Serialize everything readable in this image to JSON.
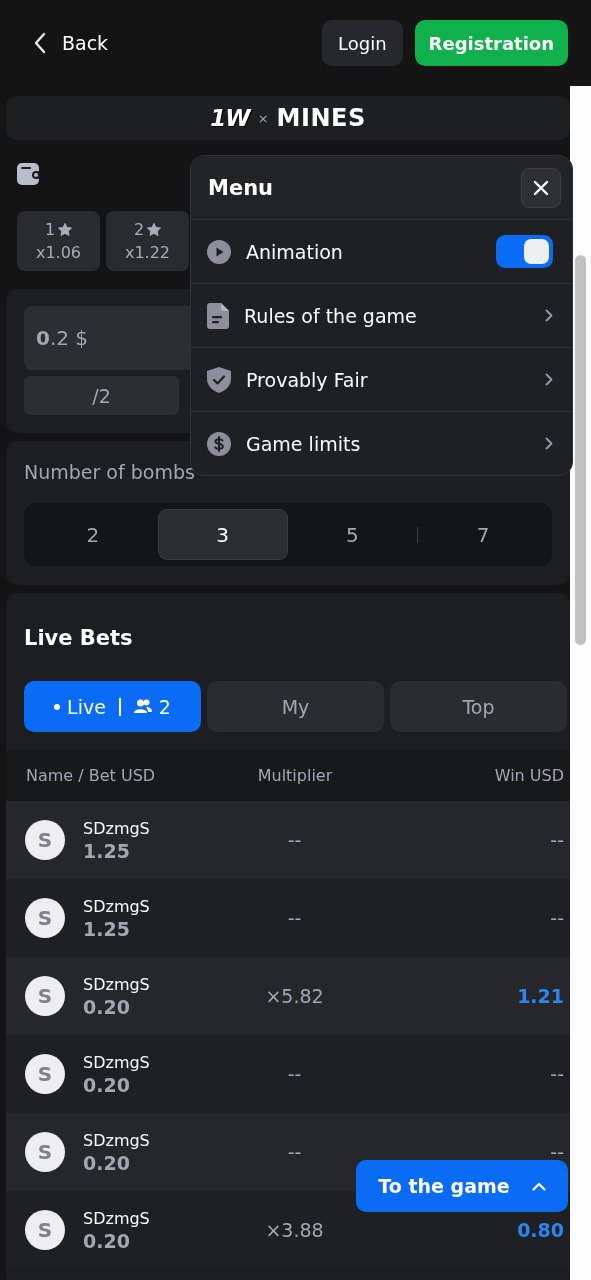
{
  "header": {
    "back_label": "Back",
    "login_label": "Login",
    "register_label": "Registration"
  },
  "logo": {
    "brand": "1W",
    "separator": "×",
    "game": "MINES"
  },
  "coefficient_chips": [
    {
      "count": "1",
      "multiplier": "x1.06"
    },
    {
      "count": "2",
      "multiplier": "x1.22"
    }
  ],
  "bet": {
    "value": "**0**.2 $",
    "half_label": "/2"
  },
  "bombs": {
    "label": "Number of bombs",
    "options": [
      {
        "label": "2",
        "selected": false
      },
      {
        "label": "3",
        "selected": true
      },
      {
        "label": "5",
        "selected": false
      },
      {
        "label": "7",
        "selected": false
      }
    ]
  },
  "live_bets": {
    "title": "Live Bets",
    "tabs": [
      {
        "label": "Live",
        "count": "2",
        "kind": "live",
        "selected": true
      },
      {
        "label": "My",
        "kind": "plain",
        "selected": false
      },
      {
        "label": "Top",
        "kind": "plain",
        "selected": false
      }
    ],
    "columns": [
      "Name / Bet USD",
      "Multiplier",
      "Win USD"
    ],
    "rows": [
      {
        "avatar": "S",
        "name": "SDzmgS",
        "bet": "**1**.25",
        "multiplier": "--",
        "win": "--",
        "won": false
      },
      {
        "avatar": "S",
        "name": "SDzmgS",
        "bet": "**1**.25",
        "multiplier": "--",
        "win": "--",
        "won": false
      },
      {
        "avatar": "S",
        "name": "SDzmgS",
        "bet": "**0**.20",
        "multiplier": "×5.82",
        "win": "1.21",
        "won": true
      },
      {
        "avatar": "S",
        "name": "SDzmgS",
        "bet": "**0**.20",
        "multiplier": "--",
        "win": "--",
        "won": false
      },
      {
        "avatar": "S",
        "name": "SDzmgS",
        "bet": "**0**.20",
        "multiplier": "--",
        "win": "--",
        "won": false
      },
      {
        "avatar": "S",
        "name": "SDzmgS",
        "bet": "**0**.20",
        "multiplier": "×3.88",
        "win": "0.80",
        "won": true
      }
    ]
  },
  "menu": {
    "title": "Menu",
    "items": [
      {
        "label": "Animation",
        "kind": "toggle",
        "on": true
      },
      {
        "label": "Rules of the game",
        "kind": "link"
      },
      {
        "label": "Provably Fair",
        "kind": "link"
      },
      {
        "label": "Game limits",
        "kind": "link"
      }
    ]
  },
  "to_game_label": "To the game"
}
